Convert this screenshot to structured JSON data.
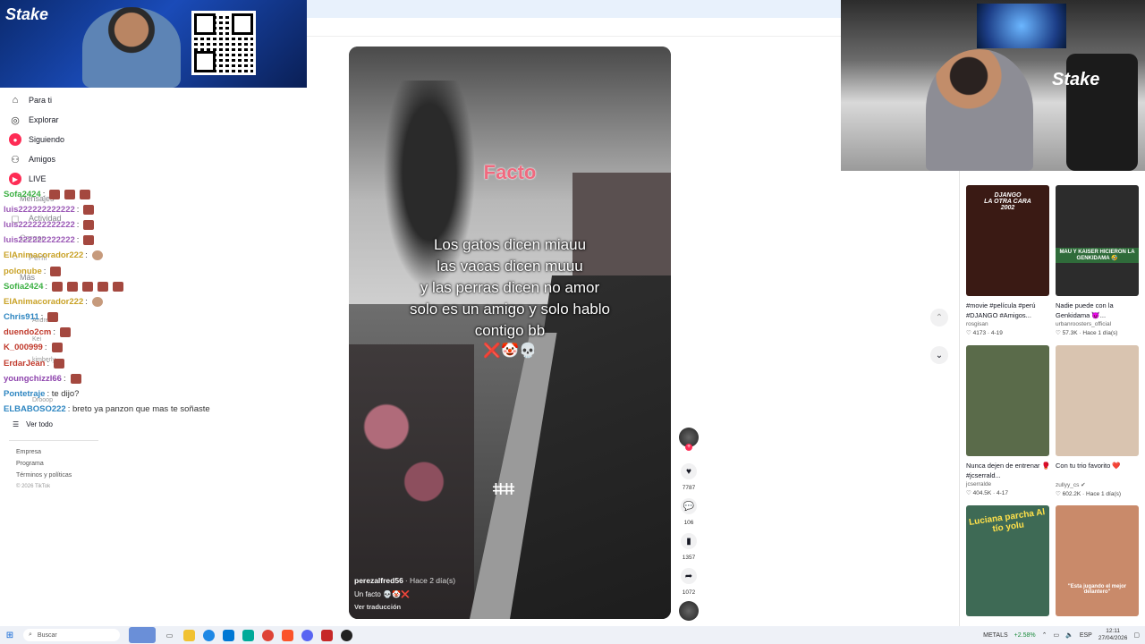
{
  "nav": {
    "items": [
      {
        "label": "Para ti",
        "icon": "home-icon"
      },
      {
        "label": "Explorar",
        "icon": "compass-icon"
      },
      {
        "label": "Siguiendo",
        "icon": "following-icon"
      },
      {
        "label": "Amigos",
        "icon": "friends-icon"
      },
      {
        "label": "LIVE",
        "icon": "live-icon"
      },
      {
        "label": "Mensajes",
        "icon": "message-icon"
      },
      {
        "label": "Actividad",
        "icon": "bell-icon"
      },
      {
        "label": "Cargar",
        "icon": "upload-icon"
      },
      {
        "label": "Perfil",
        "icon": "profile-icon"
      },
      {
        "label": "Más",
        "icon": "more-icon"
      }
    ],
    "following_accounts": [
      "Andrea",
      "Kei",
      "kimberly",
      "Drooop"
    ],
    "see_all": "Ver todo",
    "footer": [
      "Empresa",
      "Programa",
      "Términos y políticas"
    ],
    "copyright": "© 2026 TikTok"
  },
  "chat": [
    {
      "user": "Sofa2424",
      "msg": ":",
      "color": "#3cb043"
    },
    {
      "user": "luis222222222222",
      "msg": ":",
      "color": "#9b59b6"
    },
    {
      "user": "luis222222222222",
      "msg": ":",
      "color": "#9b59b6"
    },
    {
      "user": "luis222222222222",
      "msg": ":",
      "color": "#9b59b6"
    },
    {
      "user": "ElAnimacorador222",
      "msg": ":",
      "color": "#c9a227"
    },
    {
      "user": "polonube",
      "msg": ":",
      "color": "#c9a227"
    },
    {
      "user": "Sofia2424",
      "msg": ":",
      "color": "#3cb043"
    },
    {
      "user": "ElAnimacorador222",
      "msg": ":",
      "color": "#c9a227"
    },
    {
      "user": "Chris911",
      "msg": ":",
      "color": "#2e86c1"
    },
    {
      "user": "duendo2cm",
      "msg": ":",
      "color": "#c0392b"
    },
    {
      "user": "K_000999",
      "msg": ":",
      "color": "#c0392b"
    },
    {
      "user": "ErdarJean",
      "msg": ":",
      "color": "#c0392b"
    },
    {
      "user": "youngchizzl66",
      "msg": ":",
      "color": "#8e44ad"
    },
    {
      "user": "Pontetraje",
      "msg": ": te dijo?",
      "color": "#2e86c1"
    },
    {
      "user": "ELBABOSO222",
      "msg": ": breto ya panzon que mas te soñaste",
      "color": "#2e86c1"
    }
  ],
  "video": {
    "title": "Facto",
    "caption_lines": [
      "Los gatos dicen miauu",
      "las vacas dicen muuu",
      "y las perras dicen no amor",
      "solo es un amigo y solo hablo",
      "contigo bb"
    ],
    "emoji": "❌🤡💀",
    "author": "perezalfred56",
    "time": "· Hace 2 día(s)",
    "description": "Un facto 💀🤡❌",
    "translate": "Ver traducción",
    "watermark": "ⵌⵌ"
  },
  "actions": {
    "likes": "7787",
    "comments": "106",
    "saves": "1357",
    "shares": "1072"
  },
  "recommended": [
    {
      "thumb_text": "DJANGO\nLA OTRA CARA\n2002",
      "title": "#movie #película #perú #DJANGO #Amigos...",
      "user": "rosgisan",
      "stats": "♡ 4173 · 4-19",
      "bg": "#3a1a14"
    },
    {
      "thumb_text": "MAU Y KAISER HICIERON LA GENKIDAMA 🤣",
      "title": "Nadie puede con la Genkidama 😈...",
      "user": "urbanroosters_official",
      "stats": "♡ 57.3K · Hace 1 día(s)",
      "bg": "#2c2c2c"
    },
    {
      "thumb_text": "",
      "title": "Nunca dejen de entrenar 🥊 #jcserrald...",
      "user": "jcserralde",
      "stats": "♡ 404.5K · 4-17",
      "bg": "#5a6b4a"
    },
    {
      "thumb_text": "",
      "title": "Con tu trio favorito ❤️",
      "user": "zullyy_cs ✔",
      "stats": "♡ 602.2K · Hace 1 día(s)",
      "bg": "#d9c4b0"
    },
    {
      "thumb_text": "Luciana parcha Al tío yolu",
      "title": "",
      "user": "",
      "stats": "",
      "bg": "#3e6a55"
    },
    {
      "thumb_text": "\"Esta jugando el mejor delantero\"",
      "title": "",
      "user": "",
      "stats": "",
      "bg": "#c98a6a"
    }
  ],
  "taskbar": {
    "search_placeholder": "Buscar",
    "stock": "METALS",
    "stock_change": "+2.58%",
    "lang": "ESP",
    "time": "12:11",
    "date": "27/04/2026"
  },
  "overlay": {
    "brand": "Stake"
  }
}
